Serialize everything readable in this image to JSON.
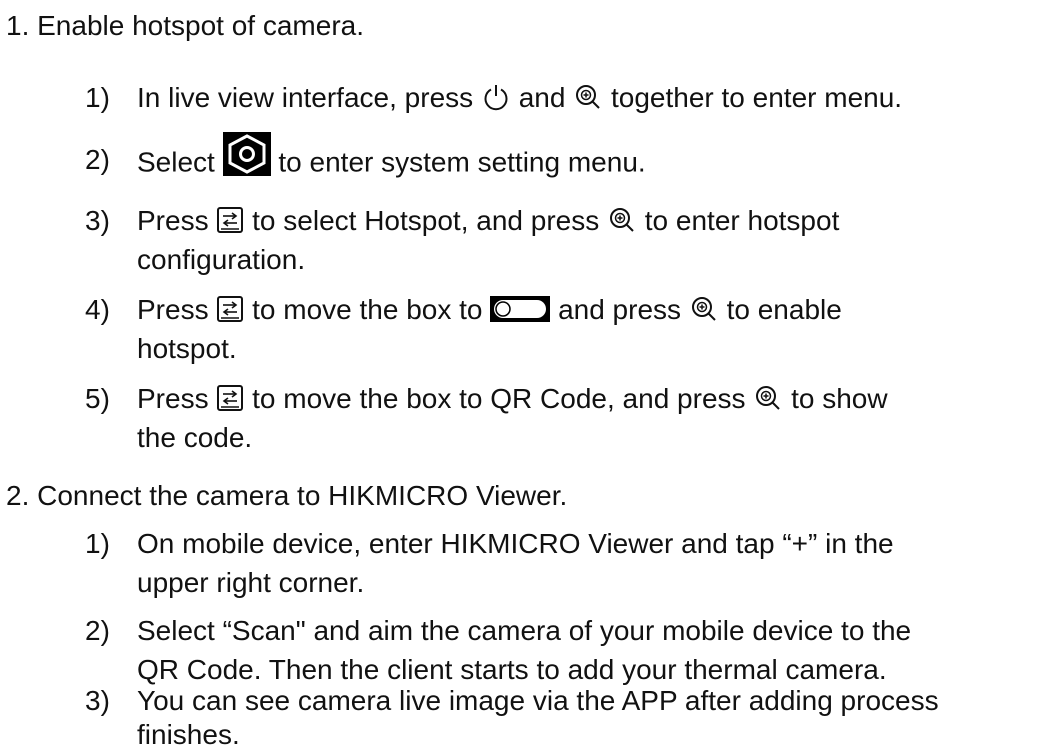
{
  "sections": [
    {
      "heading": "1. Enable hotspot of camera.",
      "steps": [
        {
          "num": "1)",
          "parts": [
            "In live view interface, press",
            "and",
            "together to enter menu."
          ],
          "icons": [
            "power-icon",
            "zoom-in-icon"
          ]
        },
        {
          "num": "2)",
          "parts": [
            "Select",
            "to enter system setting menu."
          ],
          "icons": [
            "system-settings-icon"
          ]
        },
        {
          "num": "3)",
          "parts": [
            "Press",
            "to select Hotspot, and press",
            "to enter hotspot"
          ],
          "continuation": "configuration.",
          "icons": [
            "switch-icon",
            "zoom-in-icon"
          ]
        },
        {
          "num": "4)",
          "parts": [
            "Press",
            "to move the box to",
            "and press",
            "to enable"
          ],
          "continuation": "hotspot.",
          "icons": [
            "switch-icon",
            "toggle-icon",
            "zoom-in-icon"
          ]
        },
        {
          "num": "5)",
          "parts": [
            "Press",
            "to move the box to QR Code, and press",
            "to show"
          ],
          "continuation": "the code.",
          "icons": [
            "switch-icon",
            "zoom-in-icon"
          ]
        }
      ]
    },
    {
      "heading": "2. Connect the camera to HIKMICRO Viewer.",
      "steps": [
        {
          "num": "1)",
          "line1": "On mobile device, enter HIKMICRO Viewer and tap “+” in the",
          "line2": "upper right corner."
        },
        {
          "num": "2)",
          "line1": "Select “Scan\" and aim the camera of your mobile device to the",
          "line2": "QR Code. Then the client starts to add your thermal camera."
        },
        {
          "num": "3)",
          "line1": "You can see camera live image via the APP after adding process",
          "line2": "finishes."
        }
      ]
    }
  ]
}
